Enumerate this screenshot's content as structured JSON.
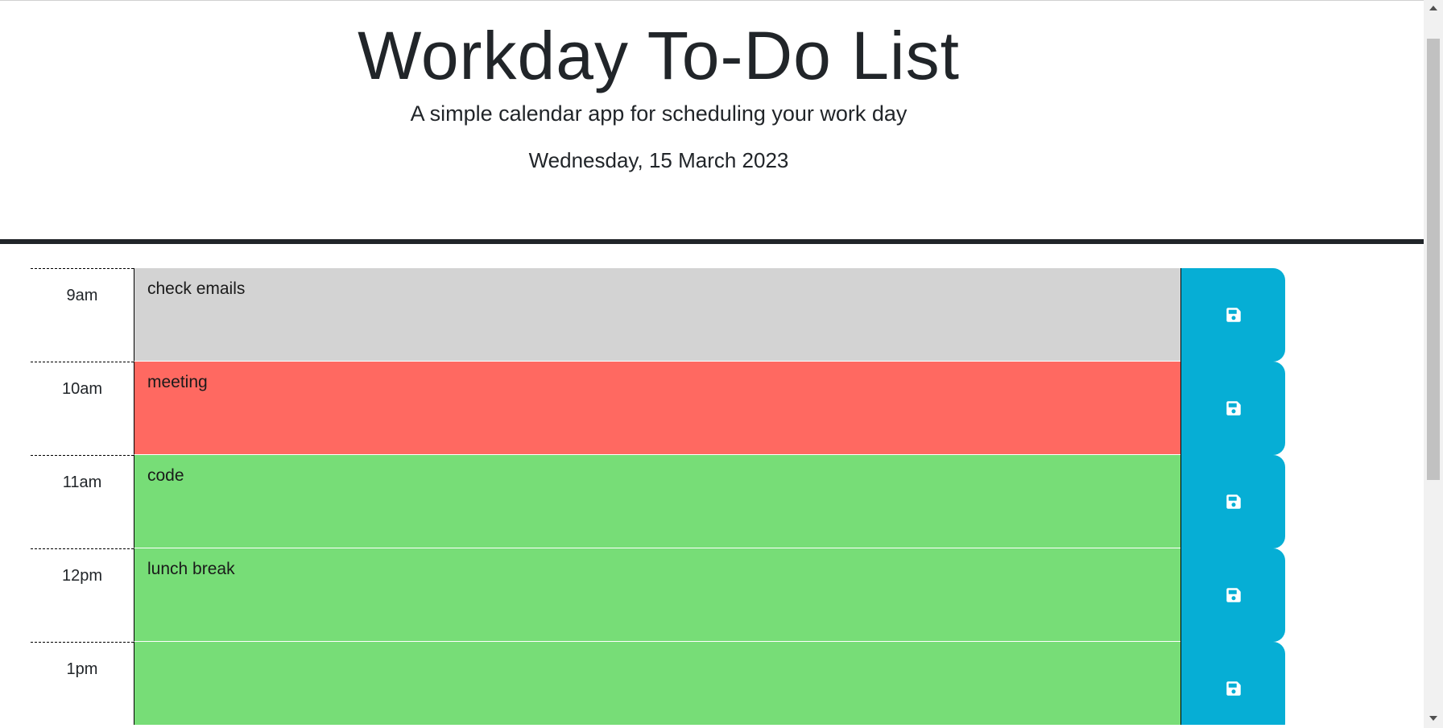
{
  "header": {
    "title": "Workday To-Do List",
    "subtitle": "A simple calendar app for scheduling your work day",
    "current_date": "Wednesday, 15 March 2023"
  },
  "colors": {
    "past": "#d3d3d3",
    "present": "#ff6961",
    "future": "#77dd77",
    "save_button": "#06aed5",
    "save_icon": "#ffffff"
  },
  "time_blocks": [
    {
      "hour": "9am",
      "description": "check emails",
      "status": "past",
      "save_icon": "floppy-disk-icon"
    },
    {
      "hour": "10am",
      "description": "meeting",
      "status": "present",
      "save_icon": "floppy-disk-icon"
    },
    {
      "hour": "11am",
      "description": "code",
      "status": "future",
      "save_icon": "floppy-disk-icon"
    },
    {
      "hour": "12pm",
      "description": "lunch break",
      "status": "future",
      "save_icon": "floppy-disk-icon"
    },
    {
      "hour": "1pm",
      "description": "",
      "status": "future",
      "save_icon": "floppy-disk-icon"
    }
  ]
}
